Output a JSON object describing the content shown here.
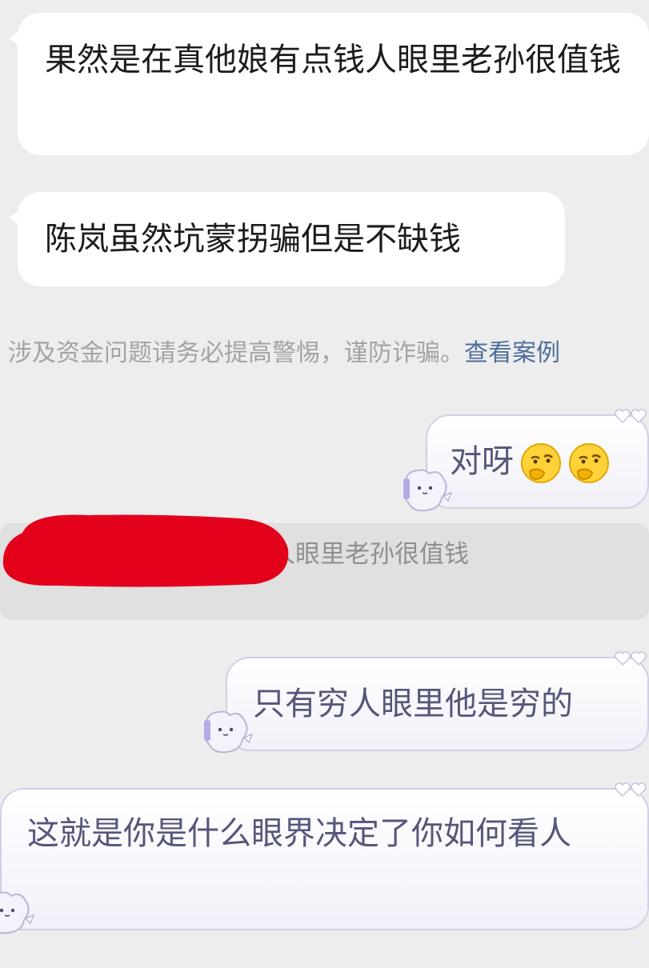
{
  "messages": [
    {
      "id": "m1",
      "side": "left",
      "text": "果然是在真他娘有点钱人眼里老孙很值钱"
    },
    {
      "id": "m2",
      "side": "left",
      "text": "陈岚虽然坑蒙拐骗但是不缺钱"
    },
    {
      "id": "m3",
      "side": "right",
      "text": "对呀",
      "emoji": [
        "thinking-face-emoji",
        "thinking-face-emoji"
      ]
    },
    {
      "id": "m4",
      "side": "right",
      "text": "只有穷人眼里他是穷的"
    },
    {
      "id": "m5",
      "side": "left",
      "text": "这就是你是什么眼界决定了你如何看人"
    }
  ],
  "system_notice": {
    "text": "涉及资金问题请务必提高警惕，谨防诈骗。",
    "link": "查看案例"
  },
  "quote": {
    "text": "果然是在真他娘有点钱人眼里老孙很值钱"
  },
  "colors": {
    "background": "#ededed",
    "white_bubble": "#ffffff",
    "lavender_bubble_border": "#cfd1e6",
    "lavender_text": "#55577a",
    "notice_text": "#a3a3a3",
    "notice_link": "#4d6f9c",
    "redaction": "#e3001b"
  }
}
